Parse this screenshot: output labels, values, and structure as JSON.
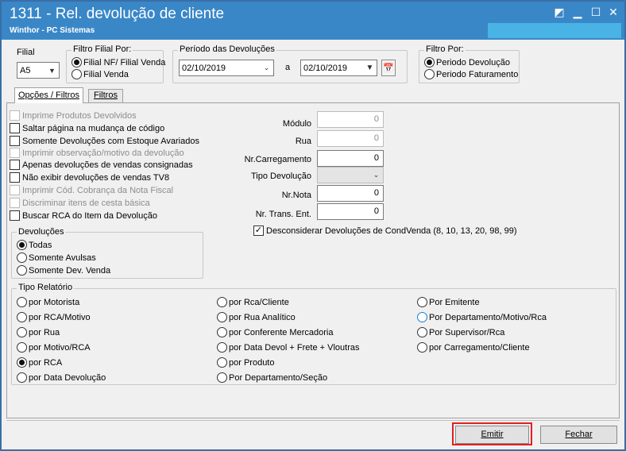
{
  "window": {
    "title": "1311 - Rel. devolução de cliente",
    "subtitle": "Winthor - PC Sistemas"
  },
  "filial": {
    "label": "Filial",
    "value": "A5"
  },
  "filtro_filial": {
    "label": "Filtro Filial Por:",
    "options": [
      "Filial NF/ Filial Venda",
      "Filial Venda"
    ],
    "selected": "Filial NF/ Filial Venda"
  },
  "periodo": {
    "label": "Período das Devoluções",
    "start": "02/10/2019",
    "sep": "a",
    "end": "02/10/2019"
  },
  "filtro_por": {
    "label": "Filtro Por:",
    "options": [
      "Periodo Devolução",
      "Periodo Faturamento"
    ],
    "selected": "Periodo Devolução"
  },
  "tabs": [
    "Opções / Filtros",
    "Filtros"
  ],
  "active_tab": "Opções / Filtros",
  "checkboxes": [
    {
      "label": "Imprime Produtos Devolvidos",
      "enabled": false,
      "checked": false
    },
    {
      "label": "Saltar página na mudança de código",
      "enabled": true,
      "checked": false
    },
    {
      "label": "Somente Devoluções com Estoque Avariados",
      "enabled": true,
      "checked": false
    },
    {
      "label": "Imprimir observação/motivo da devolução",
      "enabled": false,
      "checked": false
    },
    {
      "label": "Apenas devoluções de vendas consignadas",
      "enabled": true,
      "checked": false
    },
    {
      "label": "Não exibir devoluções de vendas TV8",
      "enabled": true,
      "checked": false
    },
    {
      "label": "Imprimir Cód. Cobrança da Nota Fiscal",
      "enabled": false,
      "checked": false
    },
    {
      "label": "Discriminar itens de cesta básica",
      "enabled": false,
      "checked": false
    },
    {
      "label": "Buscar RCA do Item da Devolução",
      "enabled": true,
      "checked": false
    }
  ],
  "devolucoes": {
    "label": "Devoluções",
    "options": [
      "Todas",
      "Somente Avulsas",
      "Somente Dev. Venda"
    ],
    "selected": "Todas"
  },
  "fields": {
    "modulo": {
      "label": "Módulo",
      "value": "0"
    },
    "rua": {
      "label": "Rua",
      "value": "0"
    },
    "carregamento": {
      "label": "Nr.Carregamento",
      "value": "0"
    },
    "tipo_devolucao": {
      "label": "Tipo Devolução",
      "value": ""
    },
    "nr_nota": {
      "label": "Nr.Nota",
      "value": "0"
    },
    "nr_trans": {
      "label": "Nr. Trans. Ent.",
      "value": "0"
    }
  },
  "desconsiderar": {
    "label": "Desconsiderar  Devoluções de CondVenda (8, 10, 13, 20, 98, 99)",
    "checked": true
  },
  "tipo_relatorio": {
    "label": "Tipo Relatório",
    "col1": [
      "por Motorista",
      "por RCA/Motivo",
      "por Rua",
      "por Motivo/RCA",
      "por RCA",
      "por Data Devolução"
    ],
    "col2": [
      "por Rca/Cliente",
      "por Rua Analítico",
      "por Conferente Mercadoria",
      "por Data Devol + Frete + Vloutras",
      "por Produto",
      "Por Departamento/Seção"
    ],
    "col3": [
      "Por Emitente",
      "Por Departamento/Motivo/Rca",
      "Por Supervisor/Rca",
      "por Carregamento/Cliente"
    ],
    "selected": "por RCA"
  },
  "buttons": {
    "emitir": "Emitir",
    "fechar": "Fechar"
  },
  "colors": {
    "titlebar": "#3a87c8",
    "highlight_border": "#e02020"
  }
}
